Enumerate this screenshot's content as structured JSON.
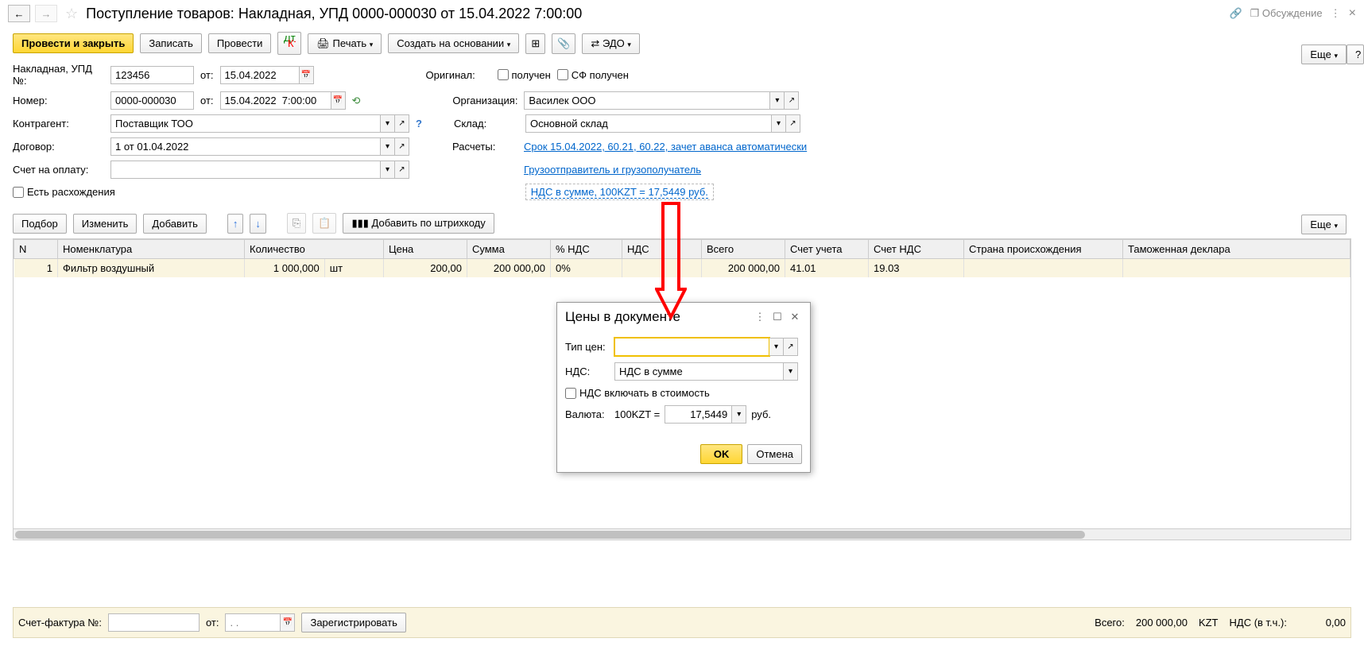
{
  "header": {
    "title": "Поступление товаров: Накладная, УПД 0000-000030 от 15.04.2022 7:00:00",
    "discuss": "Обсуждение"
  },
  "toolbar": {
    "post_close": "Провести и закрыть",
    "write": "Записать",
    "post": "Провести",
    "print": "Печать",
    "create_based": "Создать на основании",
    "edo": "ЭДО",
    "more": "Еще",
    "help": "?"
  },
  "form": {
    "invoice_lbl": "Накладная, УПД №:",
    "invoice_val": "123456",
    "from": "от:",
    "date1": "15.04.2022",
    "number_lbl": "Номер:",
    "number_val": "0000-000030",
    "date2": "15.04.2022  7:00:00",
    "original_lbl": "Оригинал:",
    "received": "получен",
    "sf_received": "СФ получен",
    "org_lbl": "Организация:",
    "org_val": "Василек ООО",
    "contr_lbl": "Контрагент:",
    "contr_val": "Поставщик ТОО",
    "warehouse_lbl": "Склад:",
    "warehouse_val": "Основной склад",
    "contract_lbl": "Договор:",
    "contract_val": "1 от 01.04.2022",
    "calc_lbl": "Расчеты:",
    "calc_link": "Срок 15.04.2022, 60.21, 60.22, зачет аванса автоматически",
    "invoice_pay_lbl": "Счет на оплату:",
    "shipper_link": "Грузоотправитель и грузополучатель",
    "expenditure": "Есть расхождения",
    "vat_link": "НДС в сумме, 100KZT = 17,5449 руб."
  },
  "tbtns": {
    "select": "Подбор",
    "change": "Изменить",
    "add": "Добавить",
    "barcode": "Добавить по штрихкоду",
    "more": "Еще"
  },
  "table": {
    "cols": {
      "n": "N",
      "nom": "Номенклатура",
      "qty": "Количество",
      "price": "Цена",
      "sum": "Сумма",
      "vatp": "% НДС",
      "vat": "НДС",
      "total": "Всего",
      "acct": "Счет учета",
      "vatacct": "Счет НДС",
      "country": "Страна происхождения",
      "customs": "Таможенная деклара"
    },
    "rows": [
      {
        "n": "1",
        "nom": "Фильтр воздушный",
        "qty": "1 000,000",
        "unit": "шт",
        "price": "200,00",
        "sum": "200 000,00",
        "vatp": "0%",
        "vat": "",
        "total": "200 000,00",
        "acct": "41.01",
        "vatacct": "19.03",
        "country": "",
        "customs": ""
      }
    ]
  },
  "footer": {
    "sf_lbl": "Счет-фактура №:",
    "from": "от:",
    "date_ph": ". .",
    "register": "Зарегистрировать",
    "total_lbl": "Всего:",
    "total_val": "200 000,00",
    "currency": "KZT",
    "vat_lbl": "НДС (в т.ч.):",
    "vat_val": "0,00"
  },
  "dlg": {
    "title": "Цены в документе",
    "type_lbl": "Тип цен:",
    "vat_lbl": "НДС:",
    "vat_val": "НДС в сумме",
    "vat_incl": "НДС включать в стоимость",
    "curr_lbl": "Валюта:",
    "curr_pre": "100KZT =",
    "curr_val": "17,5449",
    "curr_suf": "руб.",
    "ok": "OK",
    "cancel": "Отмена"
  }
}
